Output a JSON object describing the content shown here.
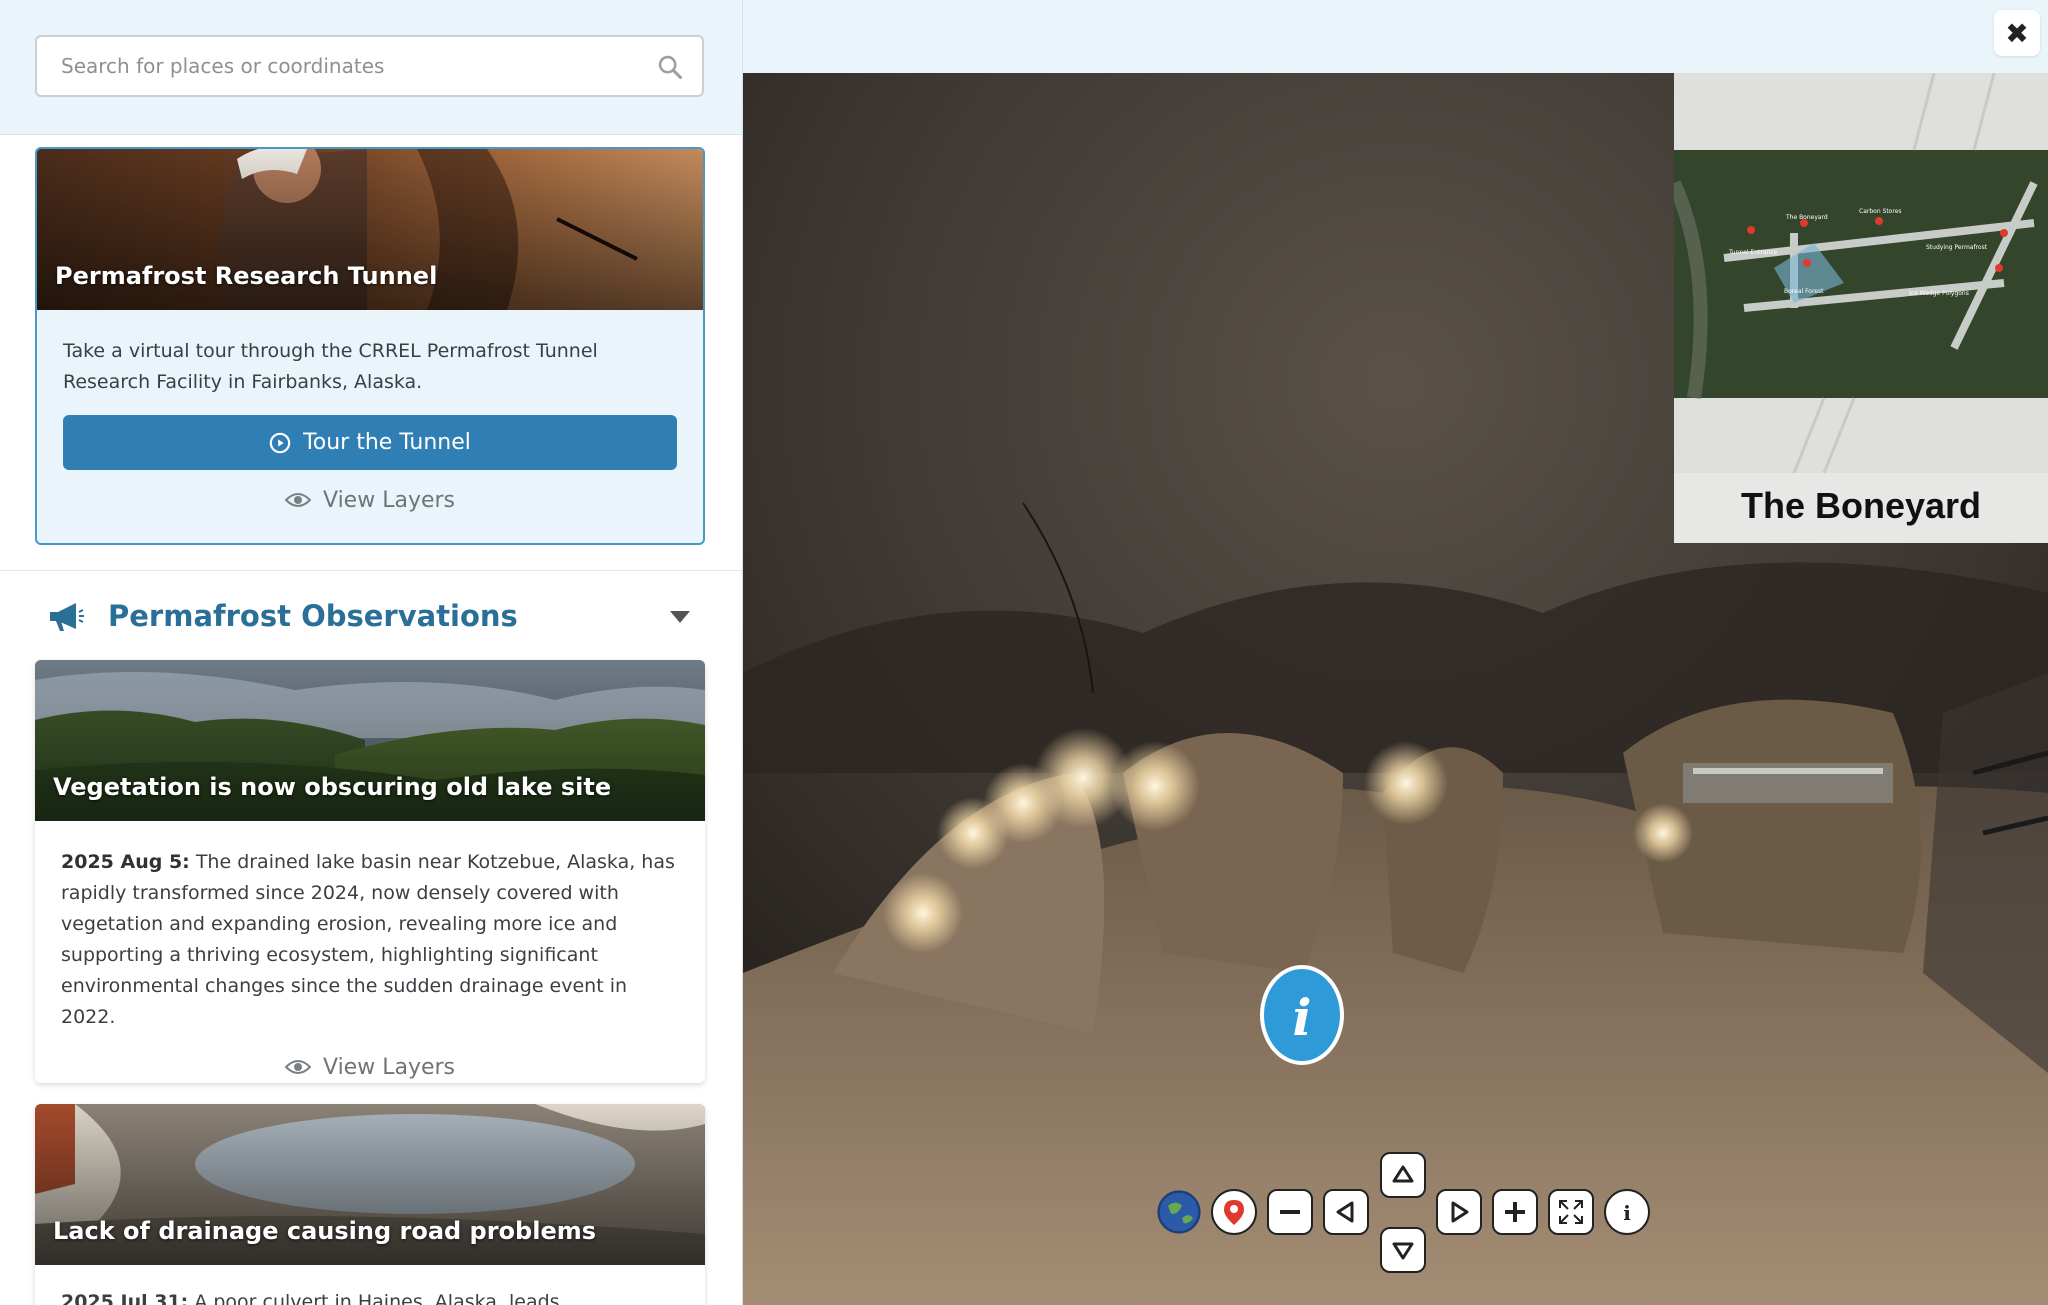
{
  "search": {
    "placeholder": "Search for places or coordinates"
  },
  "featured": {
    "title": "Permafrost Research Tunnel",
    "description": "Take a virtual tour through the CRREL Permafrost Tunnel Research Facility in Fairbanks, Alaska.",
    "tour_label": "Tour the Tunnel",
    "layers_label": "View Layers"
  },
  "observations": {
    "title": "Permafrost Observations",
    "items": [
      {
        "title": "Vegetation is now obscuring old lake site",
        "date": "2025 Aug 5:",
        "text": "The drained lake basin near Kotzebue, Alaska, has rapidly transformed since 2024, now densely covered with vegetation and expanding erosion, revealing more ice and supporting a thriving ecosystem, highlighting significant environmental changes since the sudden drainage event in 2022.",
        "layers_label": "View Layers"
      },
      {
        "title": "Lack of drainage causing road problems",
        "date": "2025 Jul 31:",
        "text": "A poor culvert in Haines, Alaska, leads"
      }
    ]
  },
  "viewer": {
    "close_label": "✖",
    "minimap": {
      "title": "The Boneyard",
      "labels": [
        "The Boneyard",
        "Carbon Stores",
        "Tunnel Entrance",
        "Studying Permafrost",
        "Boreal Forest",
        "Ice Wedge Polygons"
      ]
    },
    "controls": [
      "globe-icon",
      "map-pin-icon",
      "zoom-out-icon",
      "pan-left-icon",
      "pan-up-icon",
      "pan-down-icon",
      "pan-right-icon",
      "zoom-in-icon",
      "fullscreen-icon",
      "info-icon"
    ]
  },
  "colors": {
    "accent": "#2f7fb5",
    "section_title": "#2a6f98",
    "sidebar_bg": "#eaf4fb"
  }
}
